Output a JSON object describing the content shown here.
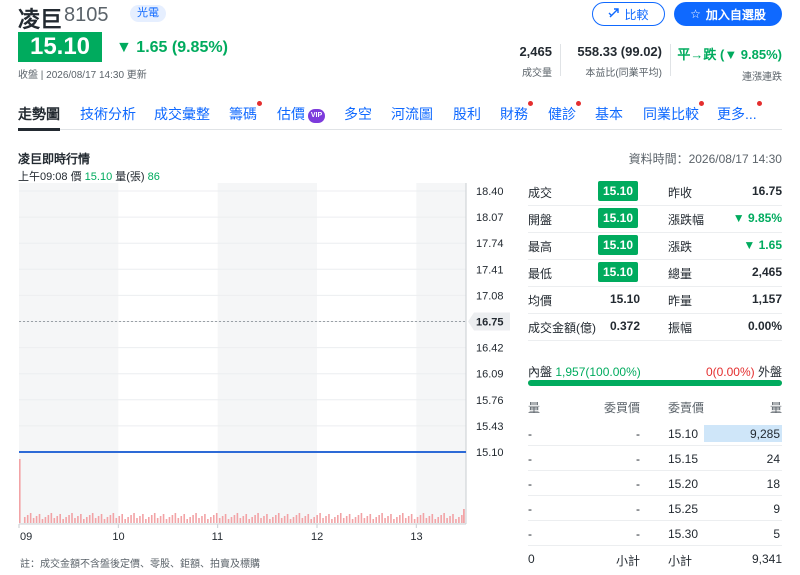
{
  "header": {
    "name": "凌巨",
    "code": "8105",
    "sector": "光電",
    "compare_label": "比較",
    "watchlist_label": "加入自選股",
    "price": "15.10",
    "change": "1.65 (9.85%)",
    "updated": "收盤 | 2026/08/17 14:30 更新"
  },
  "stats": [
    {
      "value": "2,465",
      "label": "成交量"
    },
    {
      "value": "558.33 (99.02)",
      "label": "本益比(同業平均)"
    },
    {
      "value": "平→跌 (▼ 9.85%)",
      "label": "連漲連跌"
    }
  ],
  "nav": [
    {
      "label": "走勢圖",
      "dot": false,
      "vip": false
    },
    {
      "label": "技術分析",
      "dot": false,
      "vip": false
    },
    {
      "label": "成交彙整",
      "dot": false,
      "vip": false
    },
    {
      "label": "籌碼",
      "dot": true,
      "vip": false
    },
    {
      "label": "估價",
      "dot": false,
      "vip": true
    },
    {
      "label": "多空",
      "dot": false,
      "vip": false
    },
    {
      "label": "河流圖",
      "dot": false,
      "vip": false
    },
    {
      "label": "股利",
      "dot": false,
      "vip": false
    },
    {
      "label": "財務",
      "dot": true,
      "vip": false
    },
    {
      "label": "健診",
      "dot": true,
      "vip": false
    },
    {
      "label": "基本",
      "dot": false,
      "vip": false
    },
    {
      "label": "同業比較",
      "dot": true,
      "vip": false
    },
    {
      "label": "更多...",
      "dot": true,
      "vip": false
    }
  ],
  "vip_label": "VIP",
  "section": {
    "title": "凌巨即時行情",
    "time": "資料時間：2026/08/17 14:30",
    "tick_time": "上午09:08",
    "tick_price_label": "價",
    "tick_price": "15.10",
    "tick_vol_label": "量(張)",
    "tick_vol": "86",
    "footnote": "註：成交金額不含盤後定價、零股、鉅額、拍賣及標購"
  },
  "chart_data": {
    "type": "line",
    "x_ticks": [
      "09",
      "10",
      "11",
      "12",
      "13"
    ],
    "y_ticks": [
      "18.40",
      "18.07",
      "17.74",
      "17.41",
      "17.08",
      "16.75",
      "16.42",
      "16.09",
      "15.76",
      "15.43",
      "15.10"
    ],
    "ylim": [
      15.1,
      18.4
    ],
    "prev_close": 16.75,
    "prev_close_label": "16.75",
    "price_series": [
      {
        "time": "09:00",
        "price": 15.1
      },
      {
        "time": "13:30",
        "price": 15.1
      }
    ],
    "volume_note": "first bar large (86), remaining bars small",
    "grid": true,
    "colors": {
      "line": "#2d6ad6",
      "volume": "#f2a3a6",
      "prev_close": "#9aa0a6",
      "band": "#f5f6f7"
    }
  },
  "quote": {
    "left": [
      {
        "label": "成交",
        "value": "15.10",
        "pill": true
      },
      {
        "label": "開盤",
        "value": "15.10",
        "pill": true
      },
      {
        "label": "最高",
        "value": "15.10",
        "pill": true
      },
      {
        "label": "最低",
        "value": "15.10",
        "pill": true
      },
      {
        "label": "均價",
        "value": "15.10",
        "pill": false
      },
      {
        "label": "成交金額(億)",
        "value": "0.372",
        "pill": false
      }
    ],
    "right": [
      {
        "label": "昨收",
        "value": "16.75",
        "green": false
      },
      {
        "label": "漲跌幅",
        "value": "▼ 9.85%",
        "green": true
      },
      {
        "label": "漲跌",
        "value": "▼ 1.65",
        "green": true
      },
      {
        "label": "總量",
        "value": "2,465",
        "green": false
      },
      {
        "label": "昨量",
        "value": "1,157",
        "green": false
      },
      {
        "label": "振幅",
        "value": "0.00%",
        "green": false
      }
    ]
  },
  "inout": {
    "inner_label": "內盤",
    "inner_value": "1,957(100.00%)",
    "outer_value": "0(0.00%)",
    "outer_label": "外盤",
    "inner_ratio": 1.0
  },
  "orderbook": {
    "headers": [
      "量",
      "委買價",
      "委賣價",
      "量"
    ],
    "rows": [
      {
        "bid_vol": "-",
        "bid": "-",
        "ask": "15.10",
        "ask_vol": "9,285",
        "ask_ratio": 1.0
      },
      {
        "bid_vol": "-",
        "bid": "-",
        "ask": "15.15",
        "ask_vol": "24",
        "ask_ratio": 0
      },
      {
        "bid_vol": "-",
        "bid": "-",
        "ask": "15.20",
        "ask_vol": "18",
        "ask_ratio": 0
      },
      {
        "bid_vol": "-",
        "bid": "-",
        "ask": "15.25",
        "ask_vol": "9",
        "ask_ratio": 0
      },
      {
        "bid_vol": "-",
        "bid": "-",
        "ask": "15.30",
        "ask_vol": "5",
        "ask_ratio": 0
      }
    ],
    "total_bid_vol": "0",
    "subtotal_label": "小計",
    "total_ask_vol": "9,341"
  }
}
